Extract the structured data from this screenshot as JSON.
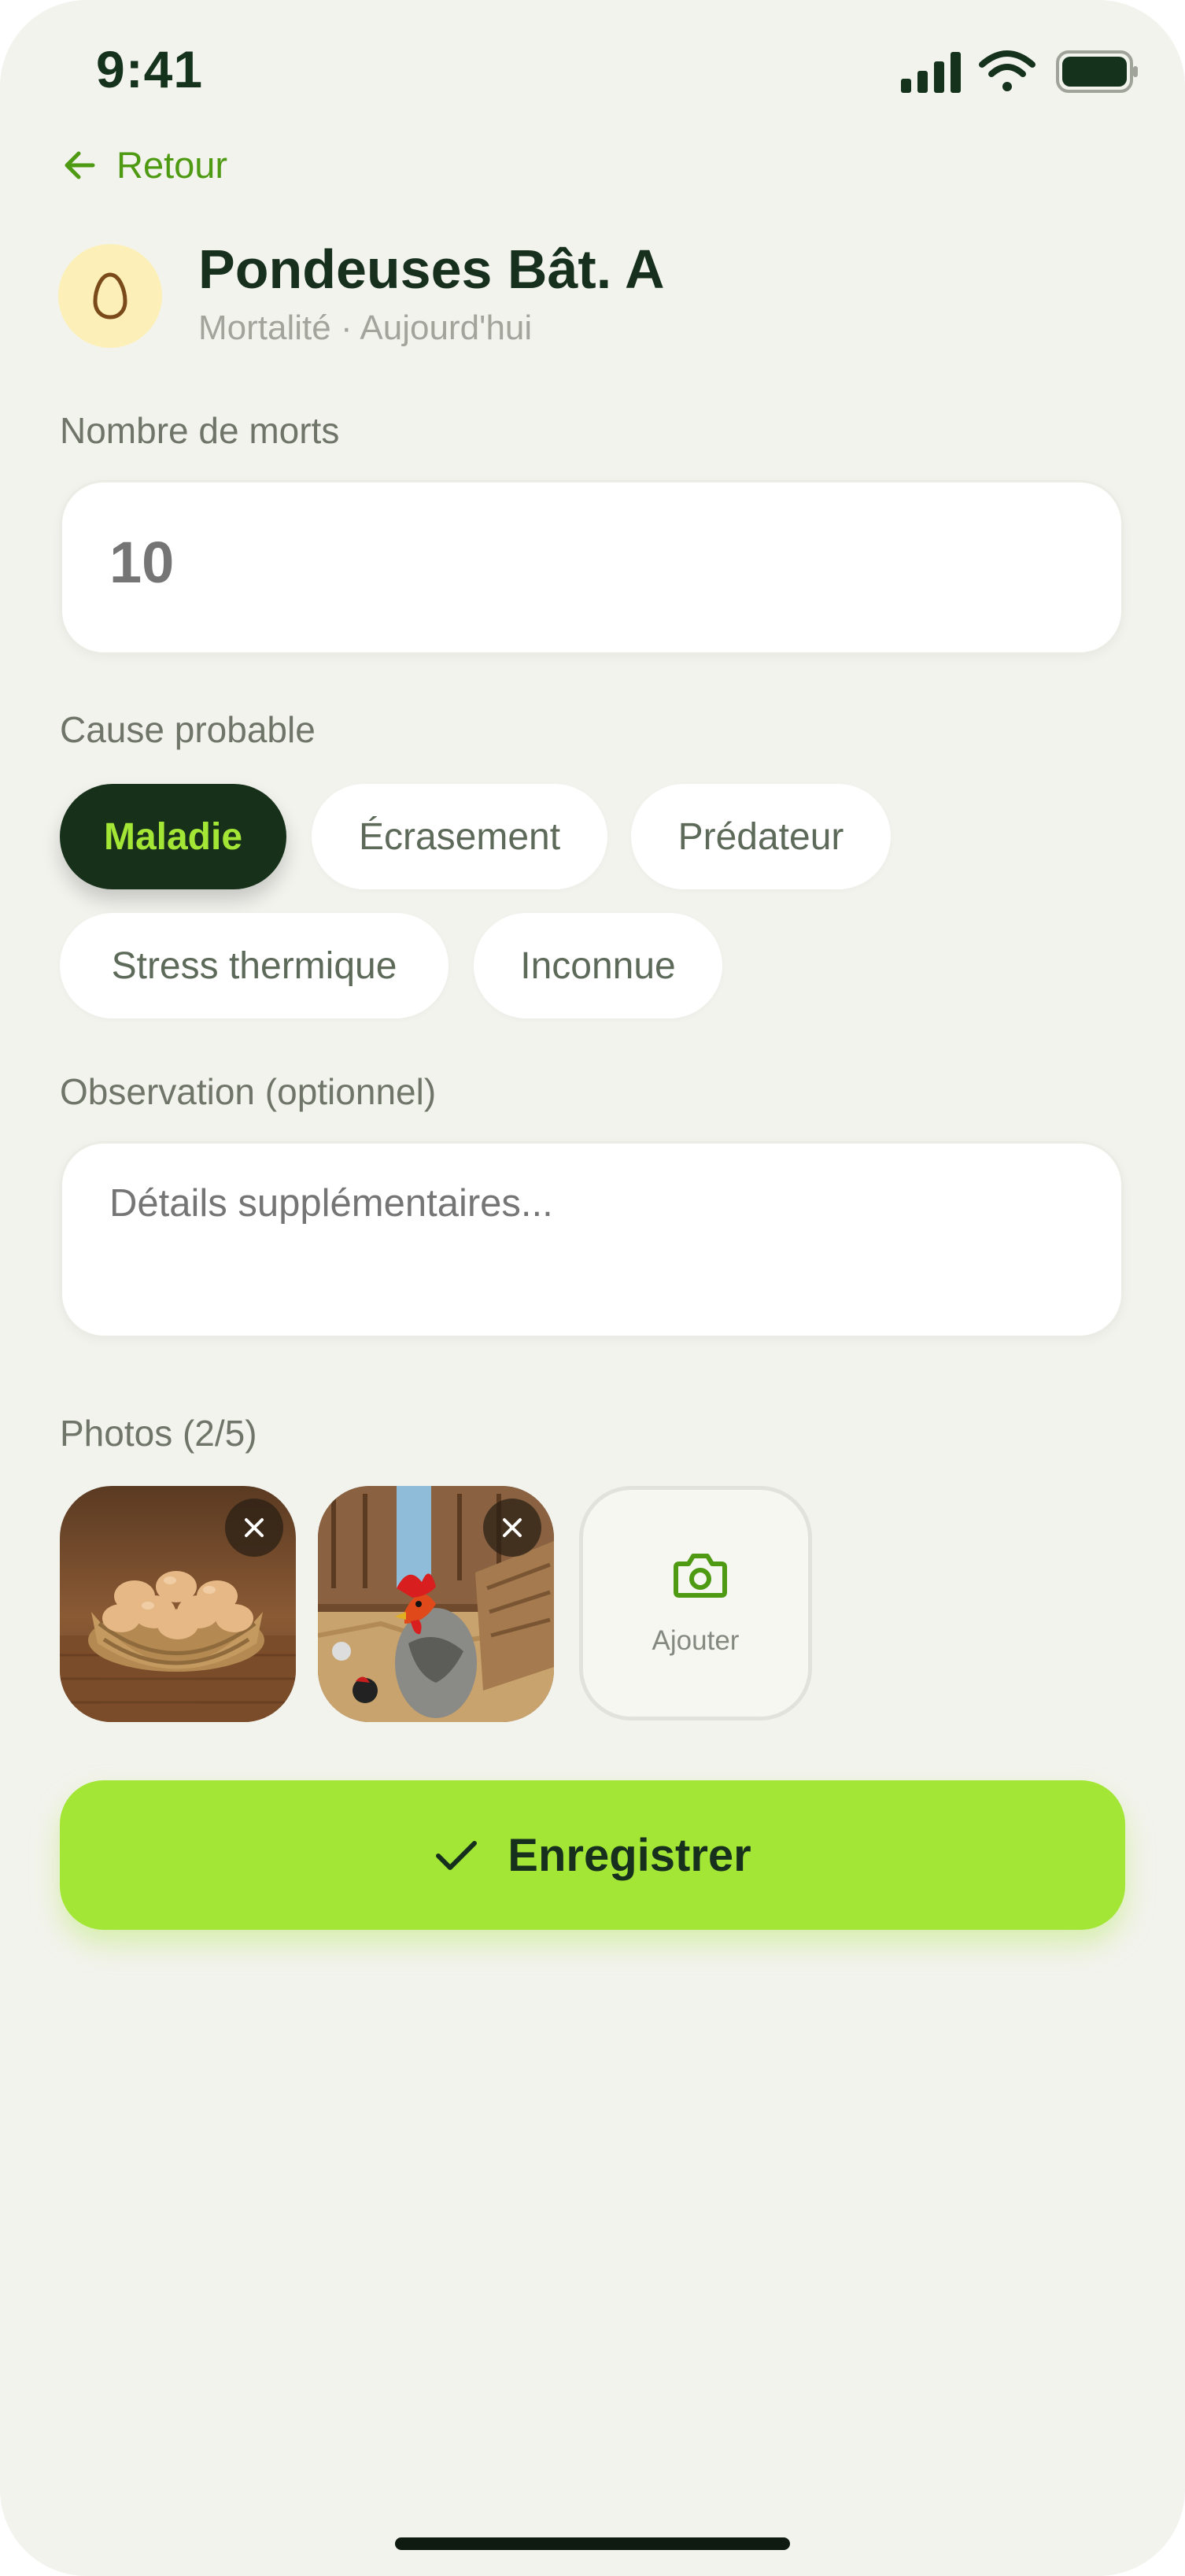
{
  "status_bar": {
    "time": "9:41",
    "icons": [
      "signal-icon",
      "wifi-icon",
      "battery-icon"
    ]
  },
  "nav": {
    "back_label": "Retour"
  },
  "header": {
    "avatar_icon": "egg-icon",
    "title": "Pondeuses Bât. A",
    "subtitle": "Mortalité · Aujourd'hui"
  },
  "form": {
    "deaths_label": "Nombre de morts",
    "deaths_placeholder": "10",
    "cause_label": "Cause probable",
    "causes": [
      {
        "label": "Maladie",
        "selected": true
      },
      {
        "label": "Écrasement",
        "selected": false
      },
      {
        "label": "Prédateur",
        "selected": false
      },
      {
        "label": "Stress thermique",
        "selected": false
      },
      {
        "label": "Inconnue",
        "selected": false
      }
    ],
    "observation_label": "Observation (optionnel)",
    "observation_placeholder": "Détails supplémentaires...",
    "photos_label": "Photos (2/5)",
    "photos": [
      {
        "subject": "basket of eggs"
      },
      {
        "subject": "rooster in henhouse"
      }
    ],
    "add_photo_label": "Ajouter"
  },
  "actions": {
    "save_label": "Enregistrer"
  },
  "colors": {
    "accent": "#a3e635",
    "dark": "#163019",
    "link": "#4f9a13",
    "background": "#f3f3ee"
  }
}
